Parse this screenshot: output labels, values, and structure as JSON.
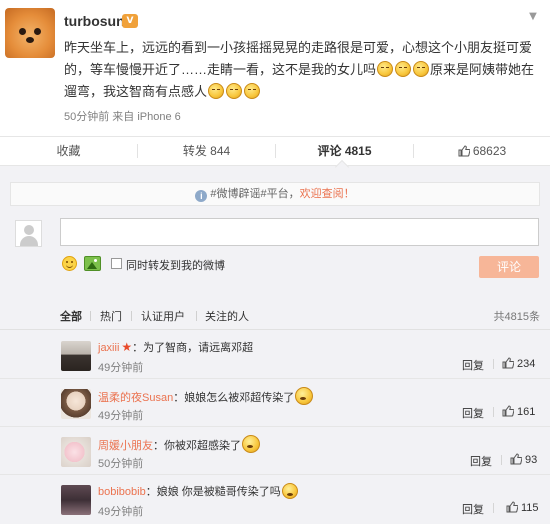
{
  "post": {
    "username": "turbosun",
    "content_line1": "昨天坐车上，远远的看到一小孩摇摇晃晃的走路很是可爱，心想这个小朋友挺可爱",
    "content_line2_a": "的，等车慢慢开近了……走睛一看，这不是我的女儿吗",
    "content_line2_b": "原来是阿姨带她在",
    "content_line3": "遛弯，我这智商有点感人",
    "meta": "50分钟前 来自 iPhone 6"
  },
  "actions": {
    "favorite": "收藏",
    "repost": "转发 844",
    "comment": "评论 4815",
    "like": "68623"
  },
  "comment_box": {
    "notice_prefix": "#微博辟谣#平台，",
    "notice_link": "欢迎查阅！",
    "input_value": "",
    "repost_label": "同时转发到我的微博",
    "submit_label": "评论"
  },
  "filters": {
    "all": "全部",
    "hot": "热门",
    "verified": "认证用户",
    "following": "关注的人",
    "total": "共4815条"
  },
  "comments": [
    {
      "user": "jaxiii",
      "text": "：为了智商，请远离邓超",
      "time": "49分钟前",
      "reply": "回复",
      "likes": "234"
    },
    {
      "user": "温柔的夜Susan",
      "text": "：娘娘怎么被邓超传染了",
      "time": "49分钟前",
      "reply": "回复",
      "likes": "161"
    },
    {
      "user": "周媛小朋友",
      "text": "：你被邓超感染了",
      "time": "50分钟前",
      "reply": "回复",
      "likes": "93"
    },
    {
      "user": "bobibobib",
      "text": "：娘娘 你是被糙哥传染了吗",
      "time": "49分钟前",
      "reply": "回复",
      "likes": "115"
    }
  ],
  "colors": {
    "accent": "#eb7350",
    "button_disabled": "#f7b698",
    "panel_bg": "#f2f2f5",
    "meta_gray": "#808080"
  },
  "icons": [
    "vip-badge-icon",
    "chevron-down-icon",
    "info-icon",
    "smile-icon",
    "image-icon",
    "thumb-up-icon",
    "star-icon",
    "emoji-icon"
  ]
}
